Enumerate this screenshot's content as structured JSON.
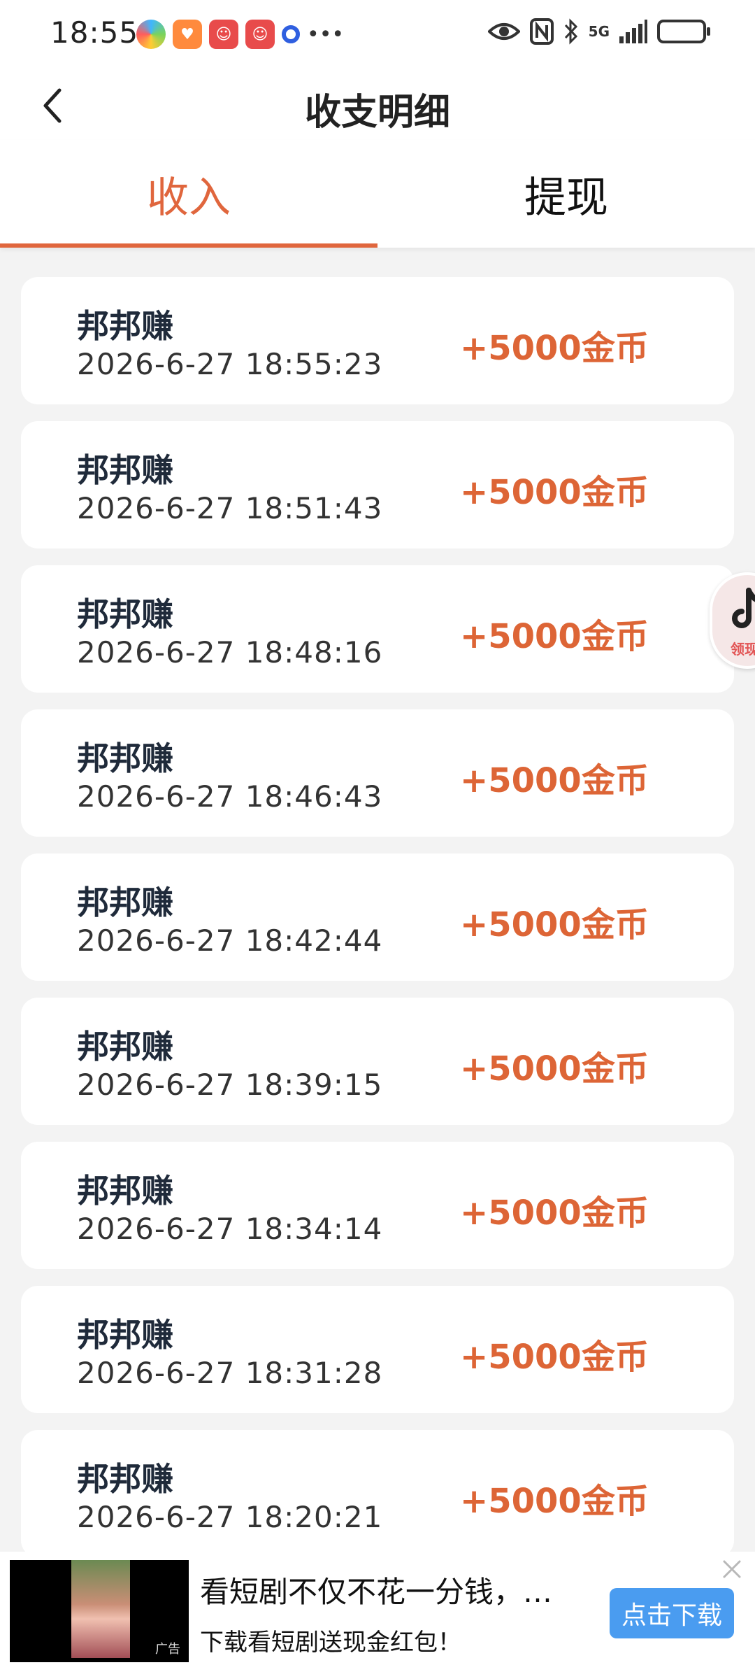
{
  "status_bar": {
    "time": "18:55",
    "network": "5G"
  },
  "header": {
    "title": "收支明细"
  },
  "tabs": [
    {
      "label": "收入",
      "active": true
    },
    {
      "label": "提现",
      "active": false
    }
  ],
  "records": [
    {
      "title": "邦邦赚",
      "time": "2026-6-27 18:55:23",
      "amount": "+5000金币"
    },
    {
      "title": "邦邦赚",
      "time": "2026-6-27 18:51:43",
      "amount": "+5000金币"
    },
    {
      "title": "邦邦赚",
      "time": "2026-6-27 18:48:16",
      "amount": "+5000金币"
    },
    {
      "title": "邦邦赚",
      "time": "2026-6-27 18:46:43",
      "amount": "+5000金币"
    },
    {
      "title": "邦邦赚",
      "time": "2026-6-27 18:42:44",
      "amount": "+5000金币"
    },
    {
      "title": "邦邦赚",
      "time": "2026-6-27 18:39:15",
      "amount": "+5000金币"
    },
    {
      "title": "邦邦赚",
      "time": "2026-6-27 18:34:14",
      "amount": "+5000金币"
    },
    {
      "title": "邦邦赚",
      "time": "2026-6-27 18:31:28",
      "amount": "+5000金币"
    },
    {
      "title": "邦邦赚",
      "time": "2026-6-27 18:20:21",
      "amount": "+5000金币"
    }
  ],
  "float_widget": {
    "label": "领现"
  },
  "ad": {
    "headline": "看短剧不仅不花一分钱，还…",
    "subline": "下载看短剧送现金红包！",
    "button": "点击下载",
    "tag": "广告"
  },
  "colors": {
    "accent": "#e0663d",
    "amount": "#dd6536",
    "ad_button": "#4a9cf0"
  }
}
